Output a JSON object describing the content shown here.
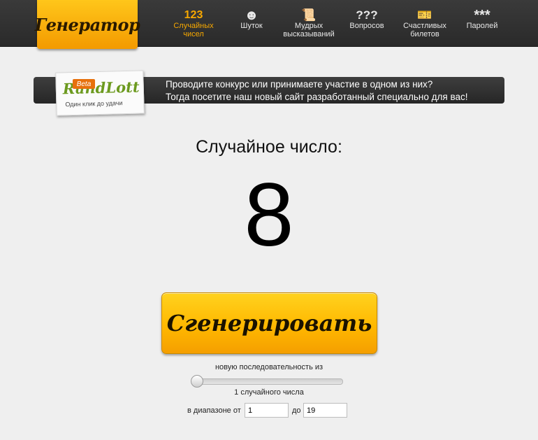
{
  "brand": {
    "logo_text": "Генератор",
    "accent_color": "#f7a800"
  },
  "nav": {
    "items": [
      {
        "icon_text": "123",
        "label": "Случайных чисел",
        "active": true
      },
      {
        "icon_text": "☻",
        "label": "Шуток",
        "active": false
      },
      {
        "icon_text": "📜",
        "label": "Мудрых высказываний",
        "active": false
      },
      {
        "icon_text": "???",
        "label": "Вопросов",
        "active": false
      },
      {
        "icon_text": "🎫",
        "label": "Счастливых билетов",
        "active": false
      },
      {
        "icon_text": "***",
        "label": "Паролей",
        "active": false
      }
    ]
  },
  "banner": {
    "logo_text": "RandLott",
    "beta_label": "Beta",
    "tagline": "Один клик до удачи",
    "line1": "Проводите конкурс или принимаете участие в одном из них?",
    "line2": "Тогда посетите наш новый сайт разработанный специально для вас!"
  },
  "main": {
    "result_label": "Случайное число:",
    "result_value": "8",
    "generate_label": "Сгенерировать"
  },
  "settings": {
    "sequence_label": "новую последовательность из",
    "count_label": "1 случайного числа",
    "count_value": 1,
    "range_from_label": "в диапазоне от",
    "range_from_value": "1",
    "range_to_label": "до",
    "range_to_value": "19"
  }
}
